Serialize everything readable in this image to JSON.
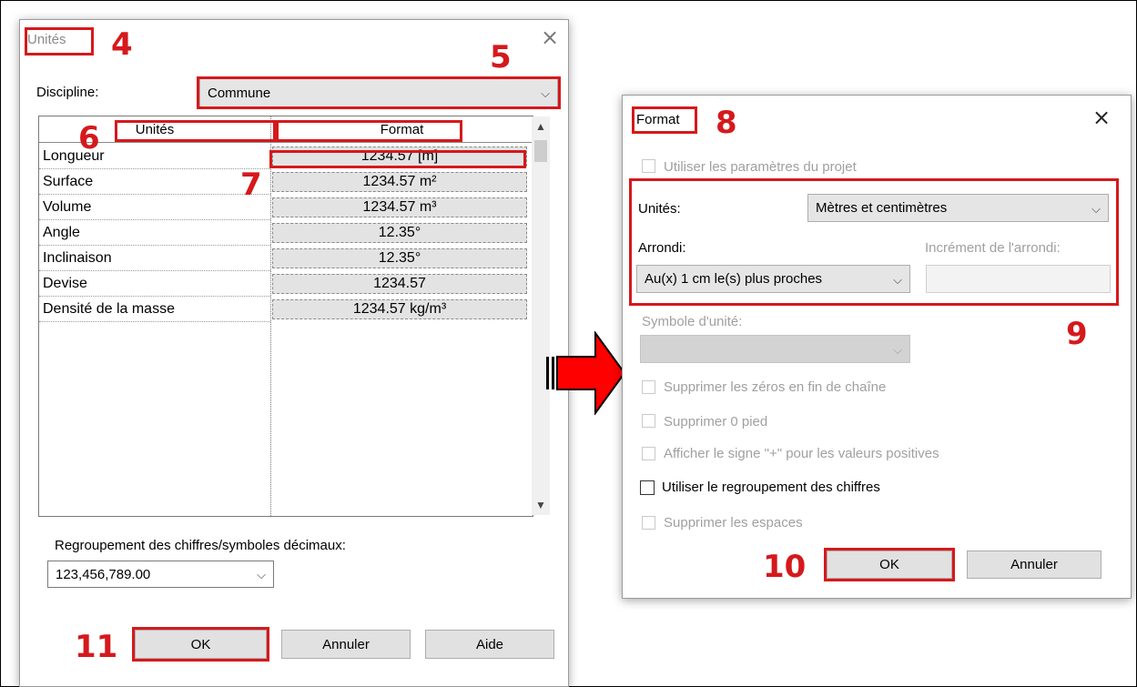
{
  "units_dialog": {
    "title": "Unités",
    "close_glyph": "×",
    "discipline_label": "Discipline:",
    "discipline_value": "Commune",
    "columns": [
      "Unités",
      "Format"
    ],
    "rows": [
      {
        "unit": "Longueur",
        "format": "1234.57 [m]"
      },
      {
        "unit": "Surface",
        "format": "1234.57 m²"
      },
      {
        "unit": "Volume",
        "format": "1234.57 m³"
      },
      {
        "unit": "Angle",
        "format": "12.35°"
      },
      {
        "unit": "Inclinaison",
        "format": "12.35°"
      },
      {
        "unit": "Devise",
        "format": "1234.57"
      },
      {
        "unit": "Densité de la masse",
        "format": "1234.57 kg/m³"
      }
    ],
    "grouping_label": "Regroupement des chiffres/symboles décimaux:",
    "grouping_value": "123,456,789.00",
    "ok_label": "OK",
    "cancel_label": "Annuler",
    "help_label": "Aide"
  },
  "format_dialog": {
    "title": "Format",
    "close_glyph": "×",
    "use_project_label": "Utiliser les paramètres du projet",
    "units_label": "Unités:",
    "units_value": "Mètres et centimètres",
    "rounding_label": "Arrondi:",
    "rounding_value": "Au(x) 1 cm le(s) plus proches",
    "rounding_increment_label": "Incrément de l'arrondi:",
    "rounding_increment_value": "",
    "unit_symbol_label": "Symbole d'unité:",
    "suppress_trailing_zeros_label": "Supprimer les zéros en fin de chaîne",
    "suppress_zero_feet_label": "Supprimer 0 pied",
    "show_plus_label": "Afficher le signe \"+\" pour les valeurs positives",
    "digit_grouping_label": "Utiliser le regroupement des chiffres",
    "suppress_spaces_label": "Supprimer les espaces",
    "ok_label": "OK",
    "cancel_label": "Annuler"
  },
  "annotations": [
    "4",
    "5",
    "6",
    "7",
    "8",
    "9",
    "10",
    "11"
  ],
  "glyphs": {
    "chevron_down": "⌵",
    "scroll_up": "▲",
    "scroll_down": "▼"
  },
  "colors": {
    "annotation_red": "#d5191c",
    "arrow_red": "#ff0000"
  }
}
